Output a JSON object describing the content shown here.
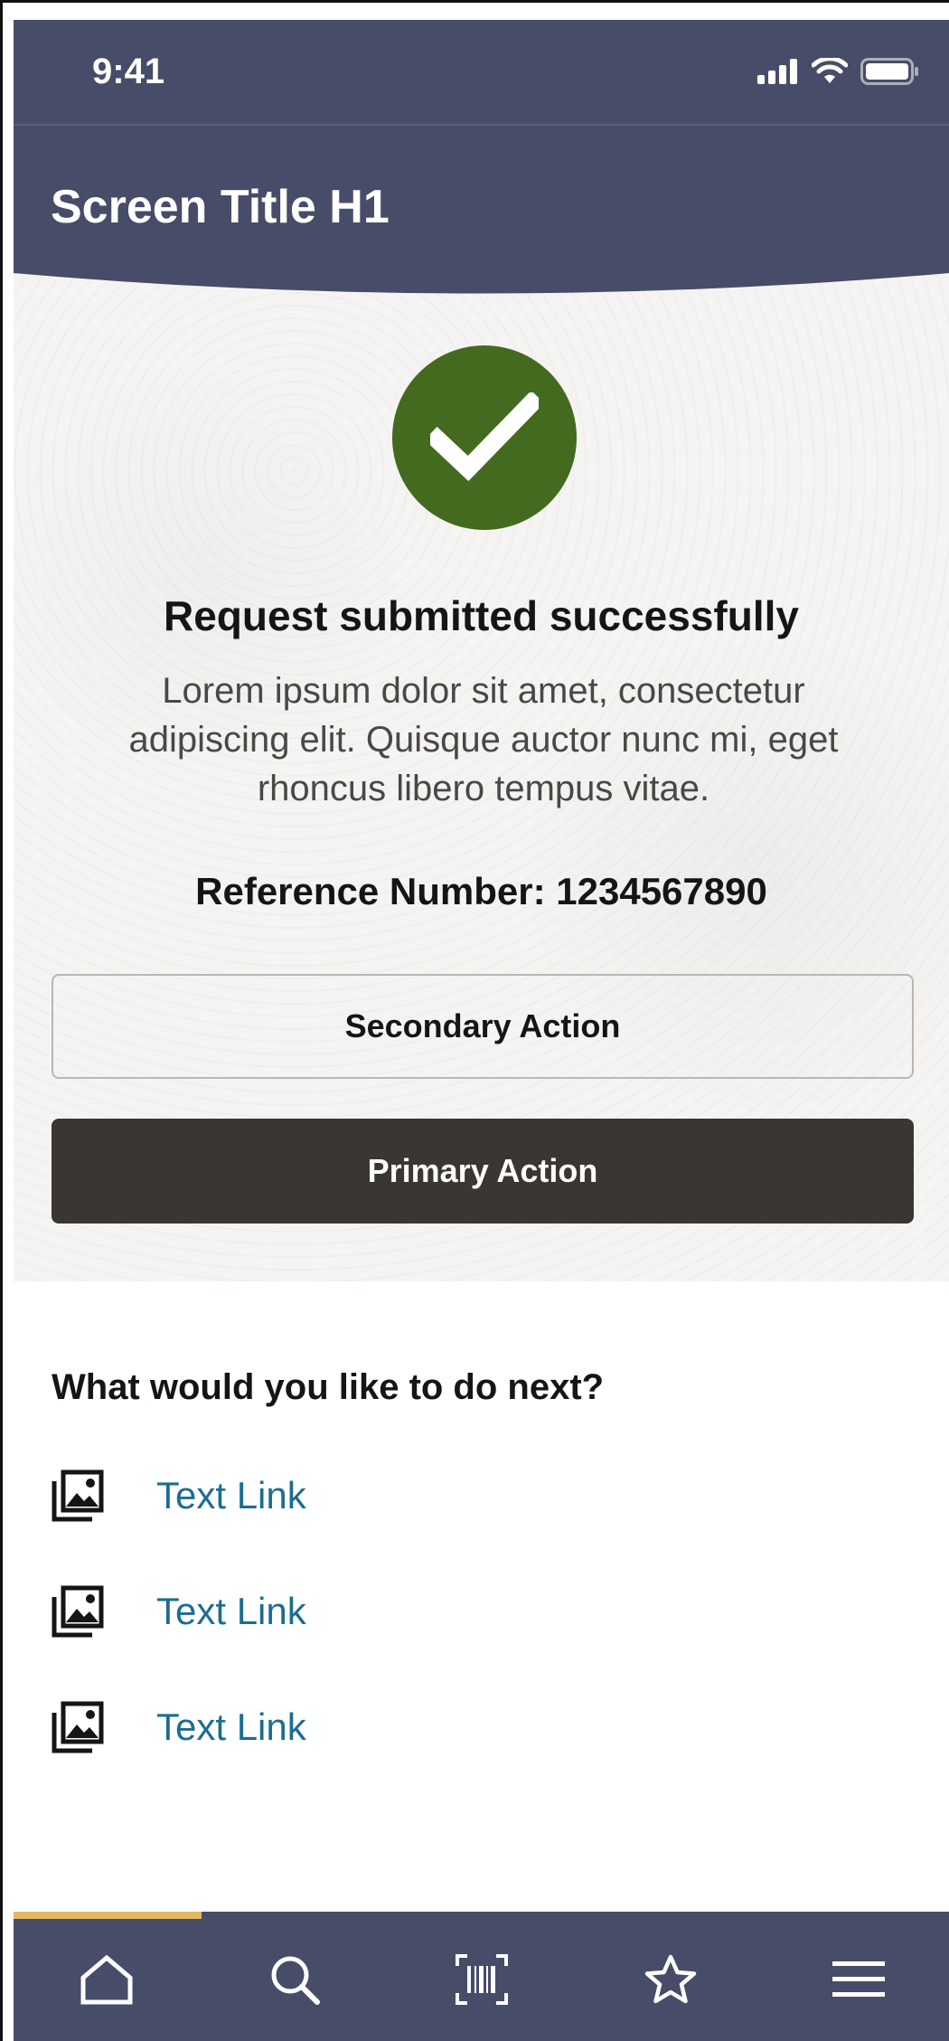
{
  "status_bar": {
    "time": "9:41",
    "icons": [
      "cellular-signal-icon",
      "wifi-icon",
      "battery-icon"
    ]
  },
  "app_bar": {
    "title": "Screen Title H1"
  },
  "confirmation": {
    "icon": "checkmark-icon",
    "title": "Request submitted successfully",
    "body": "Lorem ipsum dolor sit amet, consectetur adipiscing elit. Quisque auctor nunc mi, eget rhoncus libero tempus vitae.",
    "reference": "Reference Number: 1234567890",
    "secondary_action": "Secondary Action",
    "primary_action": "Primary Action"
  },
  "next_steps": {
    "title": "What would you like to do next?",
    "links": [
      {
        "label": "Text Link",
        "icon": "image-gallery-icon"
      },
      {
        "label": "Text Link",
        "icon": "image-gallery-icon"
      },
      {
        "label": "Text Link",
        "icon": "image-gallery-icon"
      }
    ]
  },
  "bottom_nav": {
    "items": [
      "home-icon",
      "search-icon",
      "barcode-scan-icon",
      "favorites-star-icon",
      "menu-icon"
    ],
    "active_index": 0
  },
  "colors": {
    "header": "#474c68",
    "success": "#436a1e",
    "primary_button": "#3a3632",
    "link": "#1a6e92",
    "nav_indicator": "#e4b85e"
  }
}
